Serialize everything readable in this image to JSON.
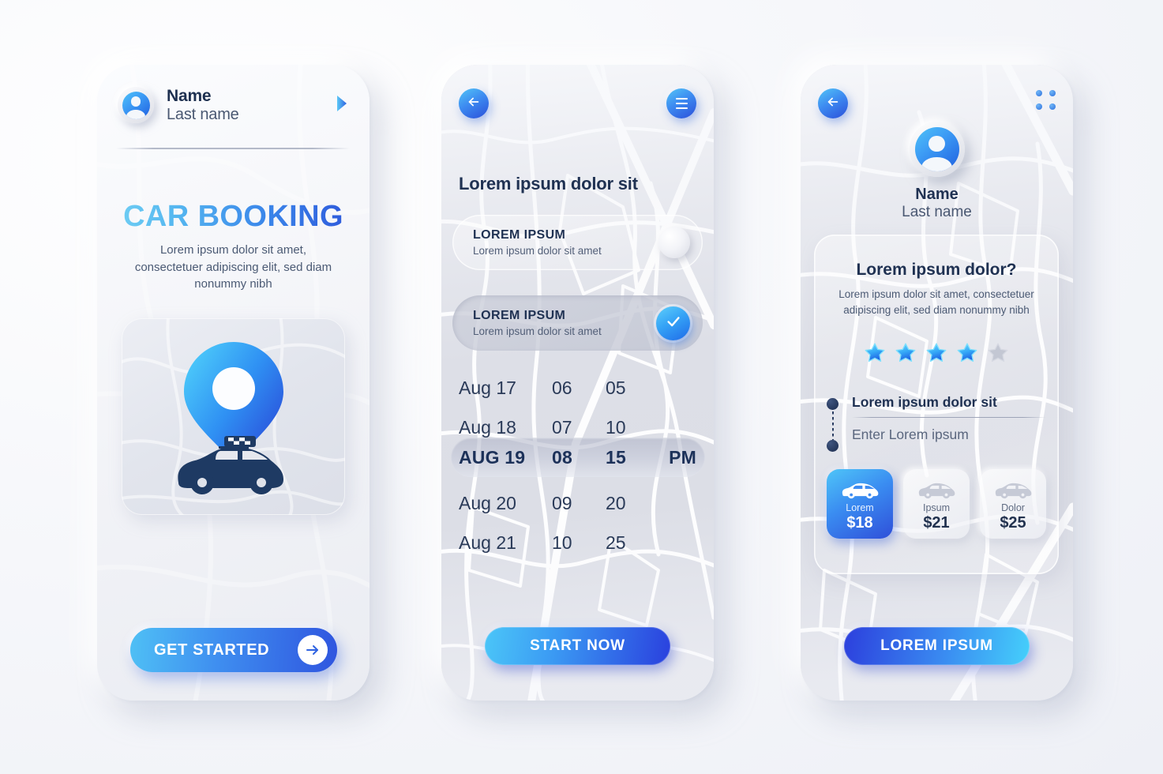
{
  "screen1": {
    "header": {
      "avatar_icon": "user-avatar-icon",
      "name": "Name",
      "last_name": "Last name",
      "chevron_icon": "chevron-right-icon"
    },
    "title": "CAR BOOKING",
    "subtitle": "Lorem ipsum dolor sit amet, consectetuer adipiscing elit, sed diam nonummy nibh",
    "illustration": {
      "pin_icon": "map-pin-icon",
      "car_icon": "taxi-car-icon"
    },
    "cta": {
      "label": "GET STARTED",
      "icon": "arrow-right-icon"
    }
  },
  "screen2": {
    "back_icon": "arrow-left-icon",
    "menu_icon": "hamburger-menu-icon",
    "title": "Lorem ipsum dolor sit",
    "options": [
      {
        "title": "LOREM IPSUM",
        "subtitle": "Lorem ipsum dolor sit amet",
        "state": "off",
        "control": "toggle-knob"
      },
      {
        "title": "LOREM IPSUM",
        "subtitle": "Lorem ipsum dolor sit amet",
        "state": "on",
        "control": "check-icon"
      }
    ],
    "picker": {
      "rows": [
        {
          "date": "Aug 17",
          "hour": "06",
          "minute": "05",
          "ampm": "",
          "selected": false
        },
        {
          "date": "Aug 18",
          "hour": "07",
          "minute": "10",
          "ampm": "",
          "selected": false
        },
        {
          "date": "AUG 19",
          "hour": "08",
          "minute": "15",
          "ampm": "PM",
          "selected": true
        },
        {
          "date": "Aug 20",
          "hour": "09",
          "minute": "20",
          "ampm": "",
          "selected": false
        },
        {
          "date": "Aug 21",
          "hour": "10",
          "minute": "25",
          "ampm": "",
          "selected": false
        }
      ]
    },
    "cta": {
      "label": "START NOW"
    }
  },
  "screen3": {
    "back_icon": "arrow-left-icon",
    "grid_icon": "grid-dots-icon",
    "avatar_icon": "user-avatar-icon",
    "name": "Name",
    "last_name": "Last name",
    "card": {
      "question": "Lorem ipsum dolor?",
      "description": "Lorem ipsum dolor sit amet, consectetuer adipiscing elit, sed diam nonummy nibh",
      "rating": {
        "filled": 4,
        "total": 5
      },
      "route": {
        "origin": "Lorem ipsum dolor sit",
        "destination_placeholder": "Enter Lorem ipsum"
      },
      "cars": [
        {
          "name": "Lorem",
          "price": "$18",
          "selected": true
        },
        {
          "name": "Ipsum",
          "price": "$21",
          "selected": false
        },
        {
          "name": "Dolor",
          "price": "$25",
          "selected": false
        }
      ]
    },
    "cta": {
      "label": "LOREM IPSUM"
    }
  },
  "colors": {
    "accent_cyan": "#4fc5f8",
    "accent_blue": "#3a8cf1",
    "accent_deep": "#2c3fdd",
    "text_dark": "#1f3152",
    "text_muted": "#4b5a74",
    "surface": "#e8e9ef"
  }
}
